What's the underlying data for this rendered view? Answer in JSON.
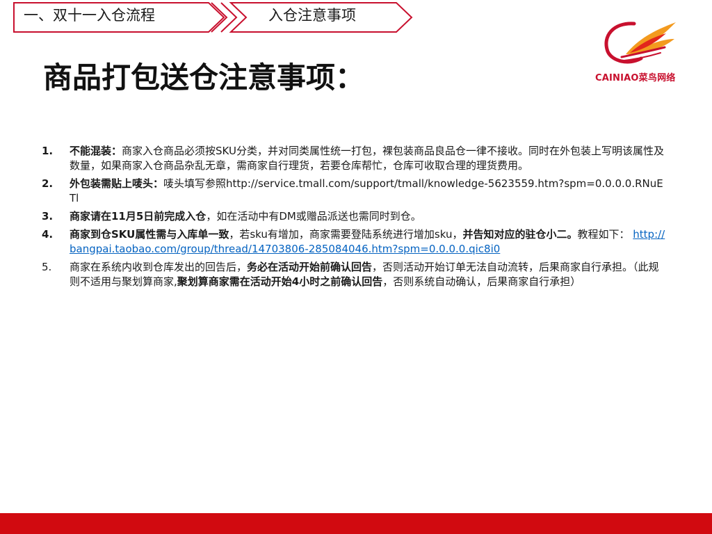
{
  "breadcrumb": {
    "step1": "一、双十一入仓流程",
    "step2": "入仓注意事项"
  },
  "logo": {
    "text": "CAINIAO菜鸟网络"
  },
  "title": "商品打包送仓注意事项：",
  "items": [
    {
      "num": "1.",
      "parts": [
        "不能混装：",
        "商家入仓商品必须按SKU分类，并对同类属性统一打包，裸包装商品良品仓一律不接收。同时在外包装上写明该属性及数量，如果商家入仓商品杂乱无章，需商家自行理货，若要仓库帮忙，仓库可收取合理的理货费用。"
      ]
    },
    {
      "num": "2.",
      "parts": [
        "外包装需贴上唛头：",
        "唛头填写参照",
        "http://service.tmall.com/support/tmall/knowledge-5623559.htm?spm=0.0.0.0.RNuETl"
      ]
    },
    {
      "num": "3.",
      "parts": [
        "商家请在11月5日前完成入仓",
        "，如在活动中有DM或赠品派送也需同时到仓。"
      ]
    },
    {
      "num": "4.",
      "parts": [
        "商家到仓SKU属性需与入库单一致",
        "，若sku有增加，商家需要登陆系统进行增加sku，",
        "并告知对应的驻仓小二。",
        "教程如下：",
        "http://bangpai.taobao.com/group/thread/14703806-285084046.htm?spm=0.0.0.0.qic8i0"
      ]
    },
    {
      "num": "5.",
      "parts": [
        "商家在系统内收到仓库发出的回告后，",
        "务必在活动开始前确认回告",
        "，否则活动开始订单无法自动流转，后果商家自行承担。（此规则不适用与聚划算商家,",
        "聚划算商家需在活动开始4小时之前确认回告",
        "，否则系统自动确认，后果商家自行承担）"
      ]
    }
  ],
  "colors": {
    "brand_red": "#d10a10",
    "link_blue": "#0563c1",
    "logo_orange": "#f39a1e"
  }
}
